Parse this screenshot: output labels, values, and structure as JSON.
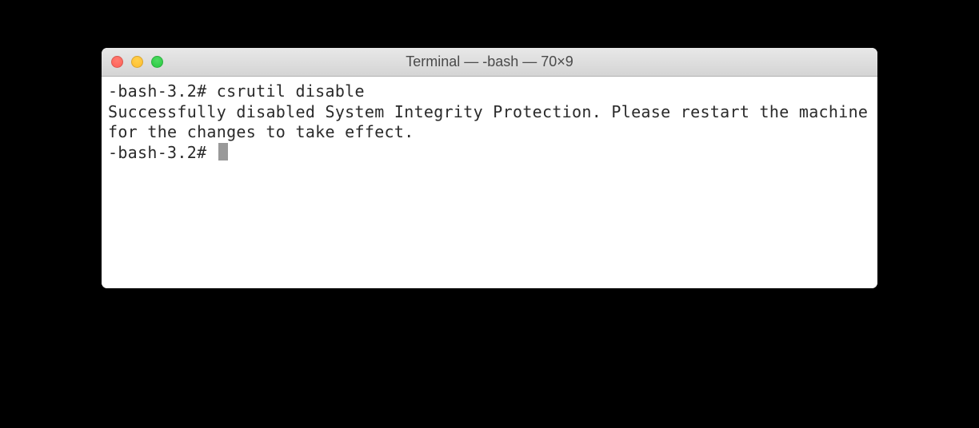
{
  "window": {
    "title": "Terminal — -bash — 70×9"
  },
  "terminal": {
    "lines": [
      "-bash-3.2# csrutil disable",
      "Successfully disabled System Integrity Protection. Please restart the machine for the changes to take effect.",
      "-bash-3.2# "
    ],
    "prompt": "-bash-3.2# ",
    "command": "csrutil disable",
    "output": "Successfully disabled System Integrity Protection. Please restart the machine for the changes to take effect."
  },
  "traffic_lights": {
    "close": "close-icon",
    "minimize": "minimize-icon",
    "maximize": "maximize-icon"
  }
}
